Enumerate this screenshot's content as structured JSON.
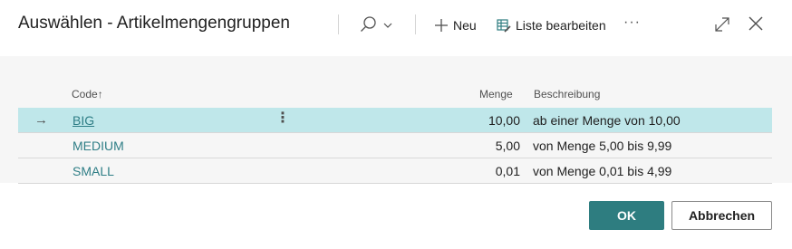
{
  "dialog": {
    "title": "Auswählen - Artikelmengengruppen"
  },
  "toolbar": {
    "search_icon": "search-icon",
    "new_label": "Neu",
    "edit_list_label": "Liste bearbeiten",
    "more_label": "···"
  },
  "table": {
    "columns": {
      "code": "Code",
      "code_sort": "↑",
      "quantity": "Menge",
      "description": "Beschreibung"
    },
    "rows": [
      {
        "code": "BIG",
        "quantity": "10,00",
        "description": "ab einer Menge von 10,00",
        "selected": true
      },
      {
        "code": "MEDIUM",
        "quantity": "5,00",
        "description": "von Menge 5,00 bis 9,99",
        "selected": false
      },
      {
        "code": "SMALL",
        "quantity": "0,01",
        "description": "von Menge 0,01 bis 4,99",
        "selected": false
      }
    ],
    "selection_arrow": "→",
    "row_menu": "⋮"
  },
  "footer": {
    "ok_label": "OK",
    "cancel_label": "Abbrechen"
  },
  "colors": {
    "accent": "#2e7d80",
    "link": "#2f7e86",
    "selected_row": "#bfe7ea"
  }
}
